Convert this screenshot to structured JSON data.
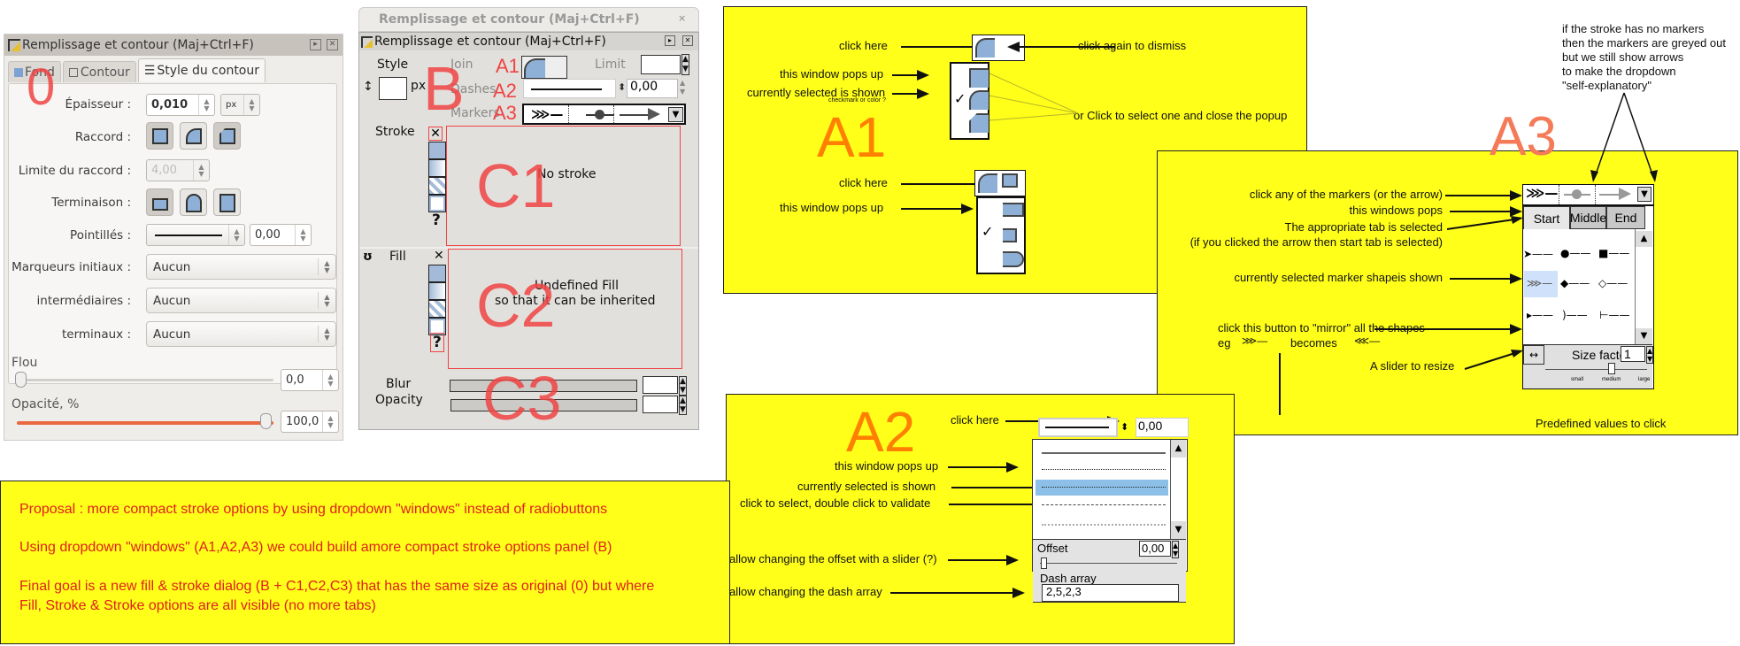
{
  "panel0": {
    "label": "0",
    "title": "Remplissage et contour (Maj+Ctrl+F)",
    "tabs": [
      {
        "label": "Fond",
        "active": false
      },
      {
        "label": "Contour",
        "active": false
      },
      {
        "label": "Style du contour",
        "active": true
      }
    ],
    "width_label": "Épaisseur :",
    "width_value": "0,010",
    "unit": "px",
    "join_label": "Raccord :",
    "miter_label": "Limite du raccord :",
    "miter_value": "4,00",
    "cap_label": "Terminaison :",
    "dash_label": "Pointillés :",
    "dash_offset": "0,00",
    "start_markers_label": "Marqueurs initiaux :",
    "start_markers_value": "Aucun",
    "mid_markers_label": "intermédiaires :",
    "mid_markers_value": "Aucun",
    "end_markers_label": "terminaux :",
    "end_markers_value": "Aucun",
    "blur_label": "Flou",
    "blur_value": "0,0",
    "blur_fraction": 0.0,
    "opacity_label": "Opacité, %",
    "opacity_value": "100,0",
    "opacity_fraction": 1.0,
    "accent_color": "#e9683f"
  },
  "panelB": {
    "label": "B",
    "back_title": "Remplissage et contour (Maj+Ctrl+F)",
    "title": "Remplissage et contour (Maj+Ctrl+F)",
    "style_label": "Style",
    "px_label": "px",
    "join_label": "Join",
    "limit_label": "Limit",
    "dashes_label": "Dashes",
    "markers_label": "Markers",
    "dash_offset": "0,00",
    "a1": "A1",
    "a2": "A2",
    "a3": "A3",
    "stroke_label": "Stroke",
    "fill_label": "Fill",
    "c1": "C1",
    "c2": "C2",
    "c3": "C3",
    "no_stroke_text": "No stroke",
    "undefined_fill_line1": "Undefined Fill",
    "undefined_fill_line2": "so that it can be inherited",
    "blur_label": "Blur",
    "opacity_label": "Opacity"
  },
  "a1": {
    "label": "A1",
    "click_here": "click here",
    "click_dismiss": "click again to dismiss",
    "pops_up": "this window pops up",
    "current_shown": "currently selected is shown",
    "checkmark_note": "checkmark or color ?",
    "select_close": "or Click to select one and close the popup",
    "click_here_2": "click here",
    "pops_up_2": "this window pops up"
  },
  "a2": {
    "label": "A2",
    "click_here": "click here",
    "offset_value": "0,00",
    "pops_up": "this window pops up",
    "current_shown": "currently selected is shown",
    "select_validate": "click to select, double click to validate",
    "offset_slider_note": "allow changing the offset with a slider (?)",
    "dash_array_note": "allow changing the dash array",
    "offset_label": "Offset",
    "offset_field": "0,00",
    "dash_array_label": "Dash array",
    "dash_array_value": "2,5,2,3"
  },
  "a3": {
    "label": "A3",
    "top_note": [
      "if the stroke has no markers",
      "then the markers are greyed out",
      "but we still show arrows",
      "to make the dropdown",
      "\"self-explanatory\""
    ],
    "click_markers": "click any of the markers (or the arrow)",
    "window_pops": "this windows pops",
    "tab_selected": "The appropriate tab is selected",
    "tab_selected_2": "(if you clicked the arrow then start tab is selected)",
    "current_marker": "currently selected marker shapeis shown",
    "mirror_note": "click this button to \"mirror\" all the shapes",
    "eg": "eg",
    "becomes": "becomes",
    "slider_note": "A slider to resize",
    "predefined_note": "Predefined values to click",
    "tabs": [
      "Start",
      "Middle",
      "End"
    ],
    "size_factor_label": "Size factor",
    "size_factor_value": "1",
    "ticks": [
      "small",
      "medium",
      "large"
    ]
  },
  "proposal": {
    "line1": "Proposal : more compact stroke options by using dropdown \"windows\" instead of radiobuttons",
    "line2": "Using dropdown \"windows\" (A1,A2,A3) we could build amore compact stroke options panel (B)",
    "line3": "Final goal is a new fill & stroke dialog (B + C1,C2,C3) that has the same size as original (0) but where",
    "line4": "Fill, Stroke & Stroke options are all visible (no more tabs)"
  }
}
